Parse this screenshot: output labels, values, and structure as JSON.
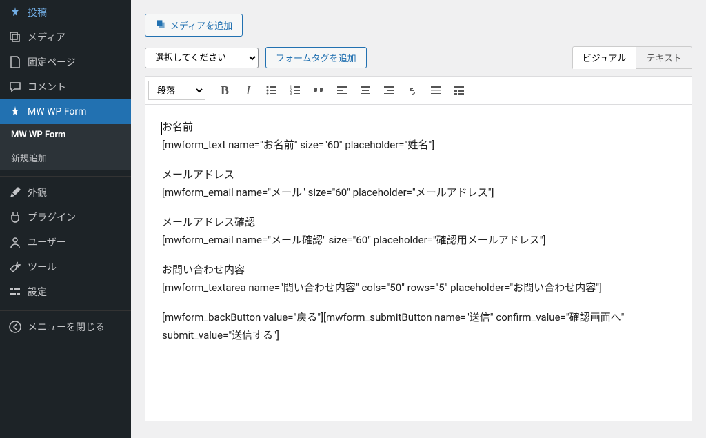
{
  "sidebar": {
    "items": [
      {
        "label": "投稿",
        "icon": "pin"
      },
      {
        "label": "メディア",
        "icon": "media"
      },
      {
        "label": "固定ページ",
        "icon": "page"
      },
      {
        "label": "コメント",
        "icon": "comment"
      },
      {
        "label": "MW WP Form",
        "icon": "pin2"
      },
      {
        "label": "外観",
        "icon": "brush"
      },
      {
        "label": "プラグイン",
        "icon": "plug"
      },
      {
        "label": "ユーザー",
        "icon": "user"
      },
      {
        "label": "ツール",
        "icon": "tool"
      },
      {
        "label": "設定",
        "icon": "settings"
      },
      {
        "label": "メニューを閉じる",
        "icon": "collapse"
      }
    ],
    "submenu": [
      {
        "label": "MW WP Form"
      },
      {
        "label": "新規追加"
      }
    ]
  },
  "actions": {
    "add_media": "メディアを追加",
    "select_placeholder": "選択してください",
    "add_form_tag": "フォームタグを追加"
  },
  "editor_tabs": {
    "visual": "ビジュアル",
    "text": "テキスト"
  },
  "toolbar": {
    "format_select": "段落"
  },
  "content": {
    "p1a": "お名前",
    "p1b": "[mwform_text name=\"お名前\" size=\"60\" placeholder=\"姓名\"]",
    "p2a": "メールアドレス",
    "p2b": "[mwform_email name=\"メール\" size=\"60\" placeholder=\"メールアドレス\"]",
    "p3a": "メールアドレス確認",
    "p3b": "[mwform_email name=\"メール確認\" size=\"60\" placeholder=\"確認用メールアドレス\"]",
    "p4a": "お問い合わせ内容",
    "p4b": "[mwform_textarea name=\"問い合わせ内容\" cols=\"50\" rows=\"5\" placeholder=\"お問い合わせ内容\"]",
    "p5": "[mwform_backButton value=\"戻る\"][mwform_submitButton name=\"送信\" confirm_value=\"確認画面へ\" submit_value=\"送信する\"]"
  }
}
